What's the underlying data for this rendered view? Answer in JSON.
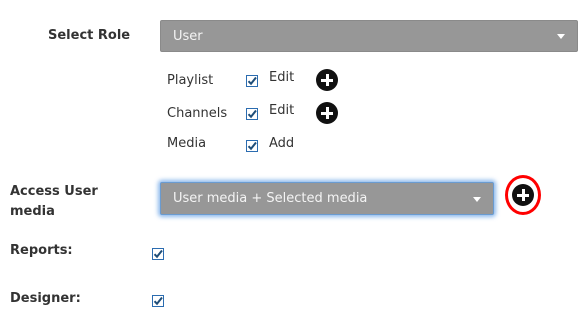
{
  "role": {
    "label": "Select Role",
    "selected": "User"
  },
  "permissions": [
    {
      "name": "Playlist",
      "checked": true,
      "action": "Edit",
      "has_add": true
    },
    {
      "name": "Channels",
      "checked": true,
      "action": "Edit",
      "has_add": true
    },
    {
      "name": "Media",
      "checked": true,
      "action": "Add",
      "has_add": false
    }
  ],
  "access_user_media": {
    "label_line1": "Access User",
    "label_line2": "media",
    "selected": "User media + Selected media"
  },
  "reports": {
    "label": "Reports:",
    "checked": true
  },
  "designer": {
    "label": "Designer:",
    "checked": true
  },
  "colors": {
    "select_bg": "#979797",
    "checkbox_border": "#2b6cb0",
    "checkmark": "#1f4e79",
    "highlight": "#ff0000",
    "focus_glow": "#66a0e6"
  },
  "icons": {
    "checkbox": "checkbox-checked-icon",
    "add": "plus-circle-icon",
    "dropdown": "caret-down-icon"
  }
}
